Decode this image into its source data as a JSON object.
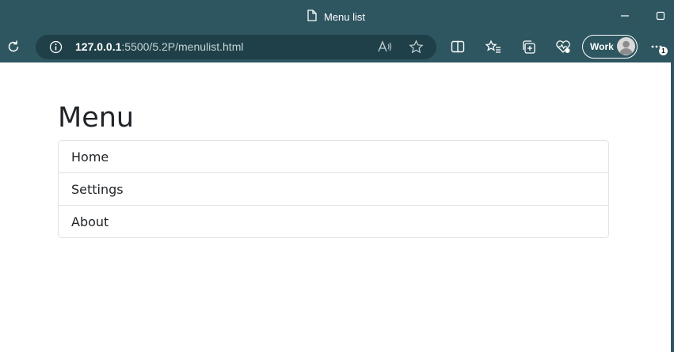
{
  "browser": {
    "tab_title": "Menu list",
    "url_host": "127.0.0.1",
    "url_rest": ":5500/5.2P/menulist.html",
    "profile_label": "Work",
    "notification_count": "1",
    "icons": [
      "page-icon",
      "minimize-icon",
      "maximize-icon",
      "reload-icon",
      "site-info-icon",
      "read-aloud-icon",
      "favorite-star-icon",
      "split-screen-icon",
      "favorites-icon",
      "collections-icon",
      "browser-essentials-icon",
      "avatar-icon",
      "more-icon"
    ]
  },
  "page": {
    "heading": "Menu",
    "menu_items": [
      {
        "label": "Home"
      },
      {
        "label": "Settings"
      },
      {
        "label": "About"
      }
    ]
  },
  "colors": {
    "frame": "#2e5660",
    "omnibox": "#1f4048",
    "page_bg": "#ffffff",
    "border": "#dee2e6",
    "text": "#212529"
  }
}
